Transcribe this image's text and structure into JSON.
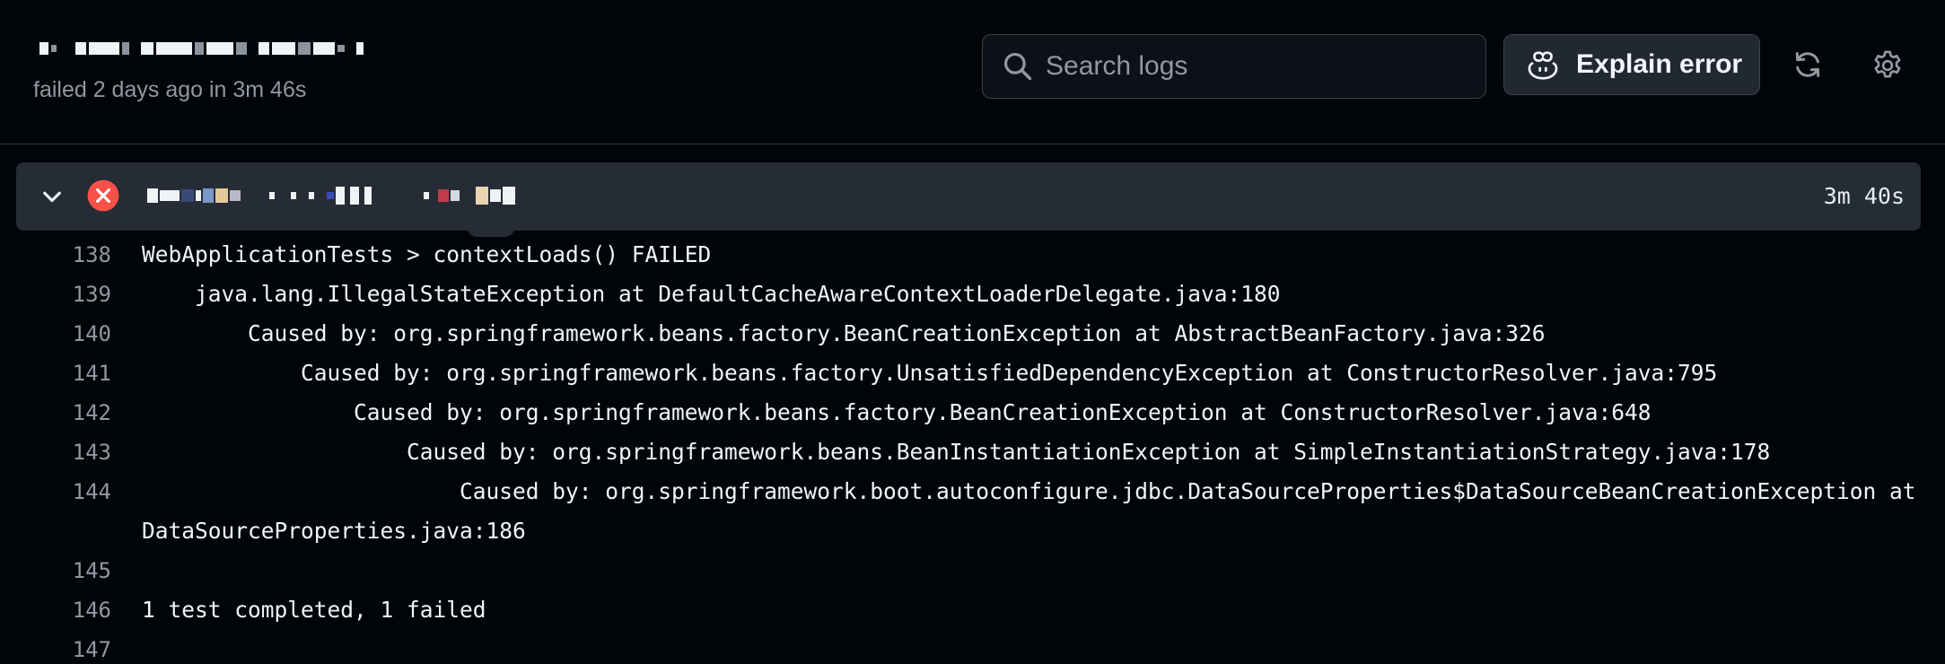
{
  "header": {
    "job_meta": "failed 2 days ago in 3m 46s",
    "search_placeholder": "Search logs",
    "explain_label": "Explain error"
  },
  "step": {
    "duration": "3m 40s",
    "status": "failed"
  },
  "icons": {
    "search": "search-icon",
    "explain": "copilot-icon",
    "refresh": "refresh-icon",
    "settings": "gear-icon",
    "collapse": "chevron-down-icon",
    "status": "x-circle-fill-icon"
  },
  "colors": {
    "background": "#010409",
    "step_bar": "#262c36",
    "fail": "#f85149",
    "muted_text": "#9198a1",
    "text": "#f0f6fc"
  },
  "log_lines": [
    {
      "number": "138",
      "text": "WebApplicationTests > contextLoads() FAILED"
    },
    {
      "number": "139",
      "text": "    java.lang.IllegalStateException at DefaultCacheAwareContextLoaderDelegate.java:180"
    },
    {
      "number": "140",
      "text": "        Caused by: org.springframework.beans.factory.BeanCreationException at AbstractBeanFactory.java:326"
    },
    {
      "number": "141",
      "text": "            Caused by: org.springframework.beans.factory.UnsatisfiedDependencyException at ConstructorResolver.java:795"
    },
    {
      "number": "142",
      "text": "                Caused by: org.springframework.beans.factory.BeanCreationException at ConstructorResolver.java:648"
    },
    {
      "number": "143",
      "text": "                    Caused by: org.springframework.beans.BeanInstantiationException at SimpleInstantiationStrategy.java:178"
    },
    {
      "number": "144",
      "text": "                        Caused by: org.springframework.boot.autoconfigure.jdbc.DataSourceProperties$DataSourceBeanCreationException at\nDataSourceProperties.java:186"
    },
    {
      "number": "145",
      "text": ""
    },
    {
      "number": "146",
      "text": "1 test completed, 1 failed"
    },
    {
      "number": "147",
      "text": ""
    }
  ]
}
